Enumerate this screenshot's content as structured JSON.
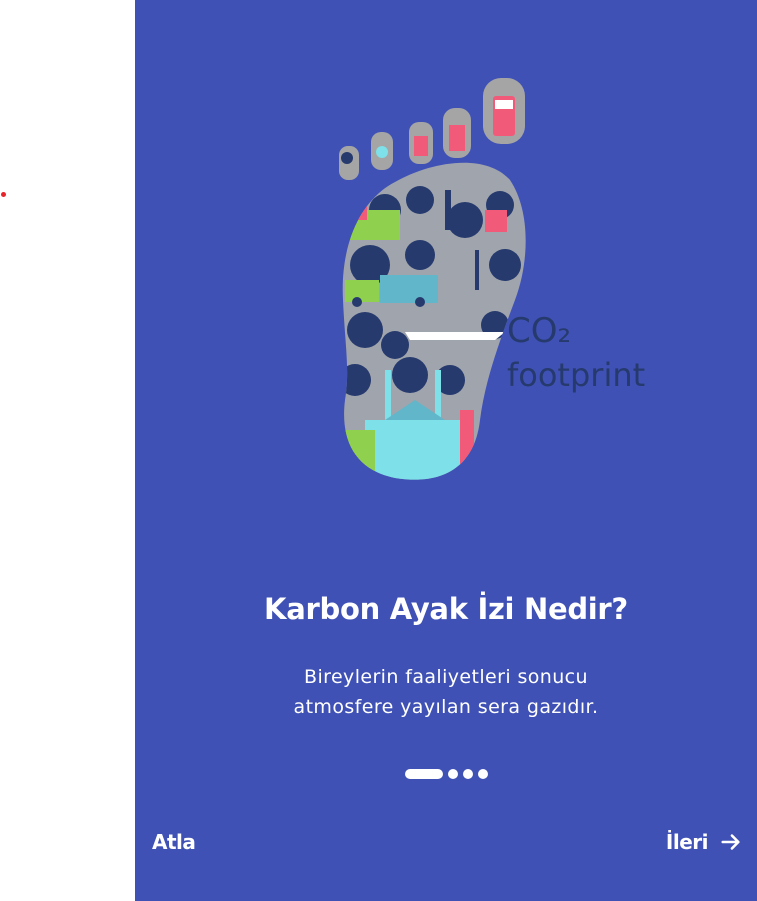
{
  "colors": {
    "background": "#3f51b5",
    "text": "#ffffff",
    "indicator": "#ffffff",
    "marker": "#e8232a"
  },
  "illustration": {
    "logo_line1": "CO₂",
    "logo_line2": "footprint"
  },
  "onboarding": {
    "title": "Karbon Ayak İzi Nedir?",
    "description": "Bireylerin faaliyetleri sonucu atmosfere yayılan sera gazıdır.",
    "page_indicator": {
      "total": 4,
      "current": 1
    }
  },
  "actions": {
    "skip_label": "Atla",
    "next_label": "İleri"
  },
  "icons": {
    "next": "arrow-right-icon"
  }
}
